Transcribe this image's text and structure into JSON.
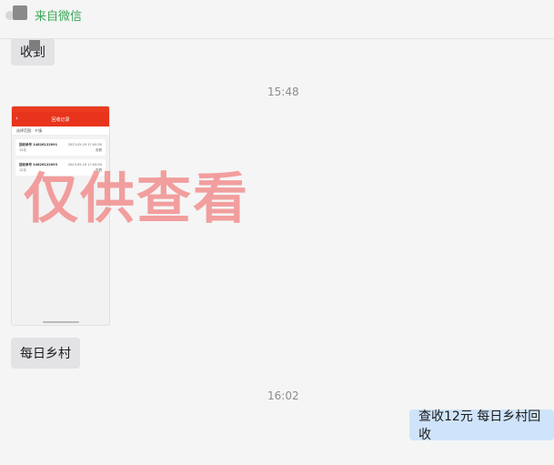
{
  "header": {
    "source_label": "来自微信"
  },
  "messages": {
    "msg1_text": "收到",
    "time1": "15:48",
    "image_caption_title": "回收记录",
    "image_filter_text": "选择范围：乡镇",
    "image_cards": [
      {
        "title": "回收单号 14826122091",
        "date": "2023-05-19 17:00:00",
        "v1": "12元",
        "v2": "查看"
      },
      {
        "title": "回收单号 14826122093",
        "date": "2023-05-19 17:00:00",
        "v1": "12元",
        "v2": "查看"
      }
    ],
    "msg2_text": "每日乡村",
    "time2": "16:02",
    "msg3_text": "查收12元 每日乡村回收",
    "watermark": "仅供查看"
  }
}
